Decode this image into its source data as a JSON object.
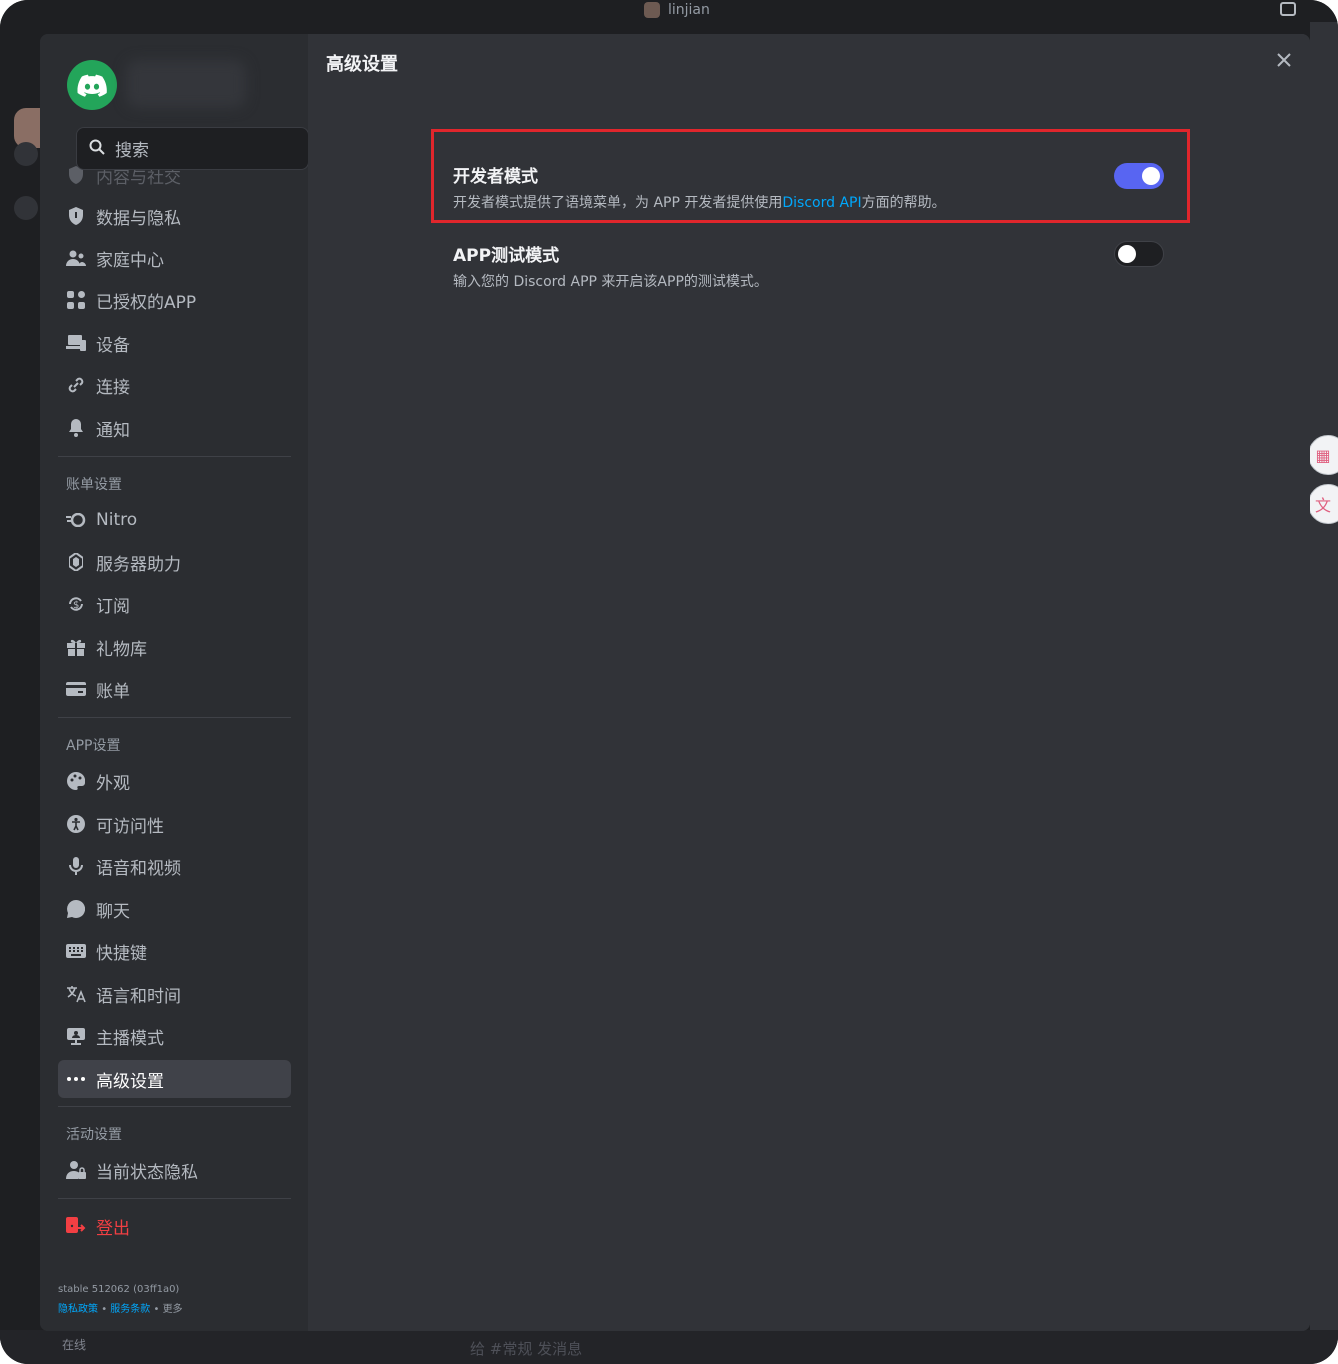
{
  "window": {
    "title": "linjian"
  },
  "search": {
    "placeholder": "搜索"
  },
  "sidebar": {
    "items_user": [
      {
        "label": "内容与社交",
        "icon": "shield-icon"
      },
      {
        "label": "数据与隐私",
        "icon": "shield-icon"
      },
      {
        "label": "家庭中心",
        "icon": "family-icon"
      },
      {
        "label": "已授权的APP",
        "icon": "apps-icon"
      },
      {
        "label": "设备",
        "icon": "devices-icon"
      },
      {
        "label": "连接",
        "icon": "link-icon"
      },
      {
        "label": "通知",
        "icon": "bell-icon"
      }
    ],
    "billing_header": "账单设置",
    "items_billing": [
      {
        "label": "Nitro",
        "icon": "nitro-icon"
      },
      {
        "label": "服务器助力",
        "icon": "boost-icon"
      },
      {
        "label": "订阅",
        "icon": "subscription-icon"
      },
      {
        "label": "礼物库",
        "icon": "gift-icon"
      },
      {
        "label": "账单",
        "icon": "card-icon"
      }
    ],
    "app_header": "APP设置",
    "items_app": [
      {
        "label": "外观",
        "icon": "palette-icon"
      },
      {
        "label": "可访问性",
        "icon": "accessibility-icon"
      },
      {
        "label": "语音和视频",
        "icon": "mic-icon"
      },
      {
        "label": "聊天",
        "icon": "chat-icon"
      },
      {
        "label": "快捷键",
        "icon": "keyboard-icon"
      },
      {
        "label": "语言和时间",
        "icon": "translate-icon"
      },
      {
        "label": "主播模式",
        "icon": "streamer-icon"
      },
      {
        "label": "高级设置",
        "icon": "more-icon"
      }
    ],
    "activity_header": "活动设置",
    "items_activity": [
      {
        "label": "当前状态隐私",
        "icon": "activity-privacy-icon"
      }
    ],
    "logout": "登出",
    "version": "stable 512062 (03ff1a0)",
    "footer": {
      "privacy": "隐私政策",
      "terms": "服务条款",
      "more": "更多",
      "sep": "•"
    }
  },
  "main": {
    "title": "高级设置",
    "settings": [
      {
        "title": "开发者模式",
        "desc_before": "开发者模式提供了语境菜单，为 APP 开发者提供使用",
        "desc_link": "Discord API",
        "desc_after": "方面的帮助。",
        "enabled": true
      },
      {
        "title": "APP测试模式",
        "desc_before": "输入您的 Discord APP 来开启该APP的测试模式。",
        "desc_link": "",
        "desc_after": "",
        "enabled": false
      }
    ]
  },
  "background": {
    "status": "在线",
    "message_placeholder": "给 #常规 发消息"
  },
  "colors": {
    "accent": "#5865f2",
    "highlight": "#e0262c",
    "link": "#00a8fc",
    "danger": "#f23f43",
    "brand_green": "#23a55a"
  }
}
